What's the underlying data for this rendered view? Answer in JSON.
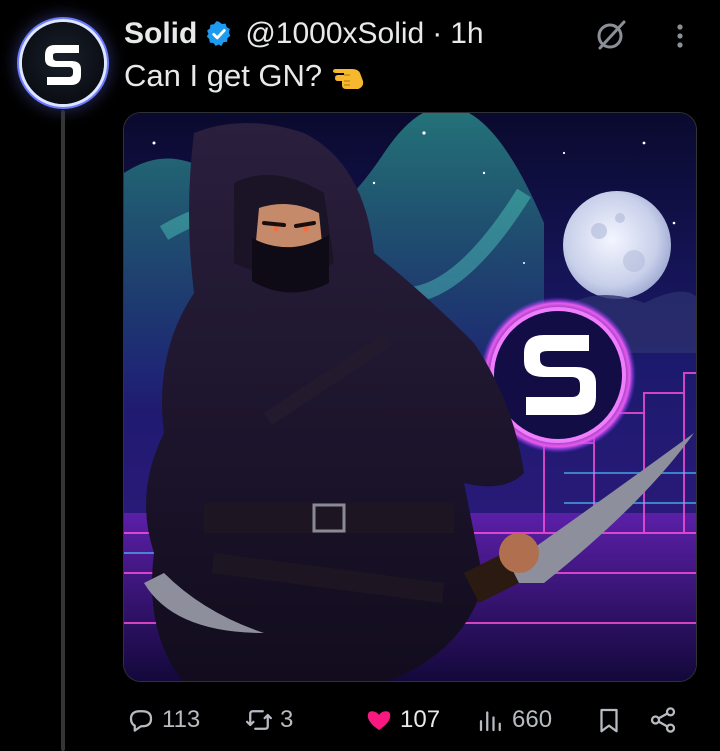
{
  "tweet": {
    "display_name": "Solid",
    "handle": "@1000xSolid",
    "separator": "·",
    "time": "1h",
    "text": "Can I get GN?",
    "emoji": "🫷",
    "verified": true
  },
  "avatar": {
    "letter": "S"
  },
  "media": {
    "alt": ""
  },
  "actions": {
    "replies": "113",
    "retweets": "3",
    "likes": "107",
    "views": "660"
  },
  "colors": {
    "background": "#000000",
    "text": "#e7e9ea",
    "muted": "#b8bcc2",
    "verified": "#1d9bf0",
    "like": "#f91880",
    "thread_line": "#333639"
  },
  "icons": {
    "verified": "verified-badge-icon",
    "grok": "grok-icon",
    "more": "more-vertical-icon",
    "reply": "reply-icon",
    "retweet": "retweet-icon",
    "like": "heart-icon",
    "views": "views-chart-icon",
    "bookmark": "bookmark-icon",
    "share": "share-icon"
  }
}
